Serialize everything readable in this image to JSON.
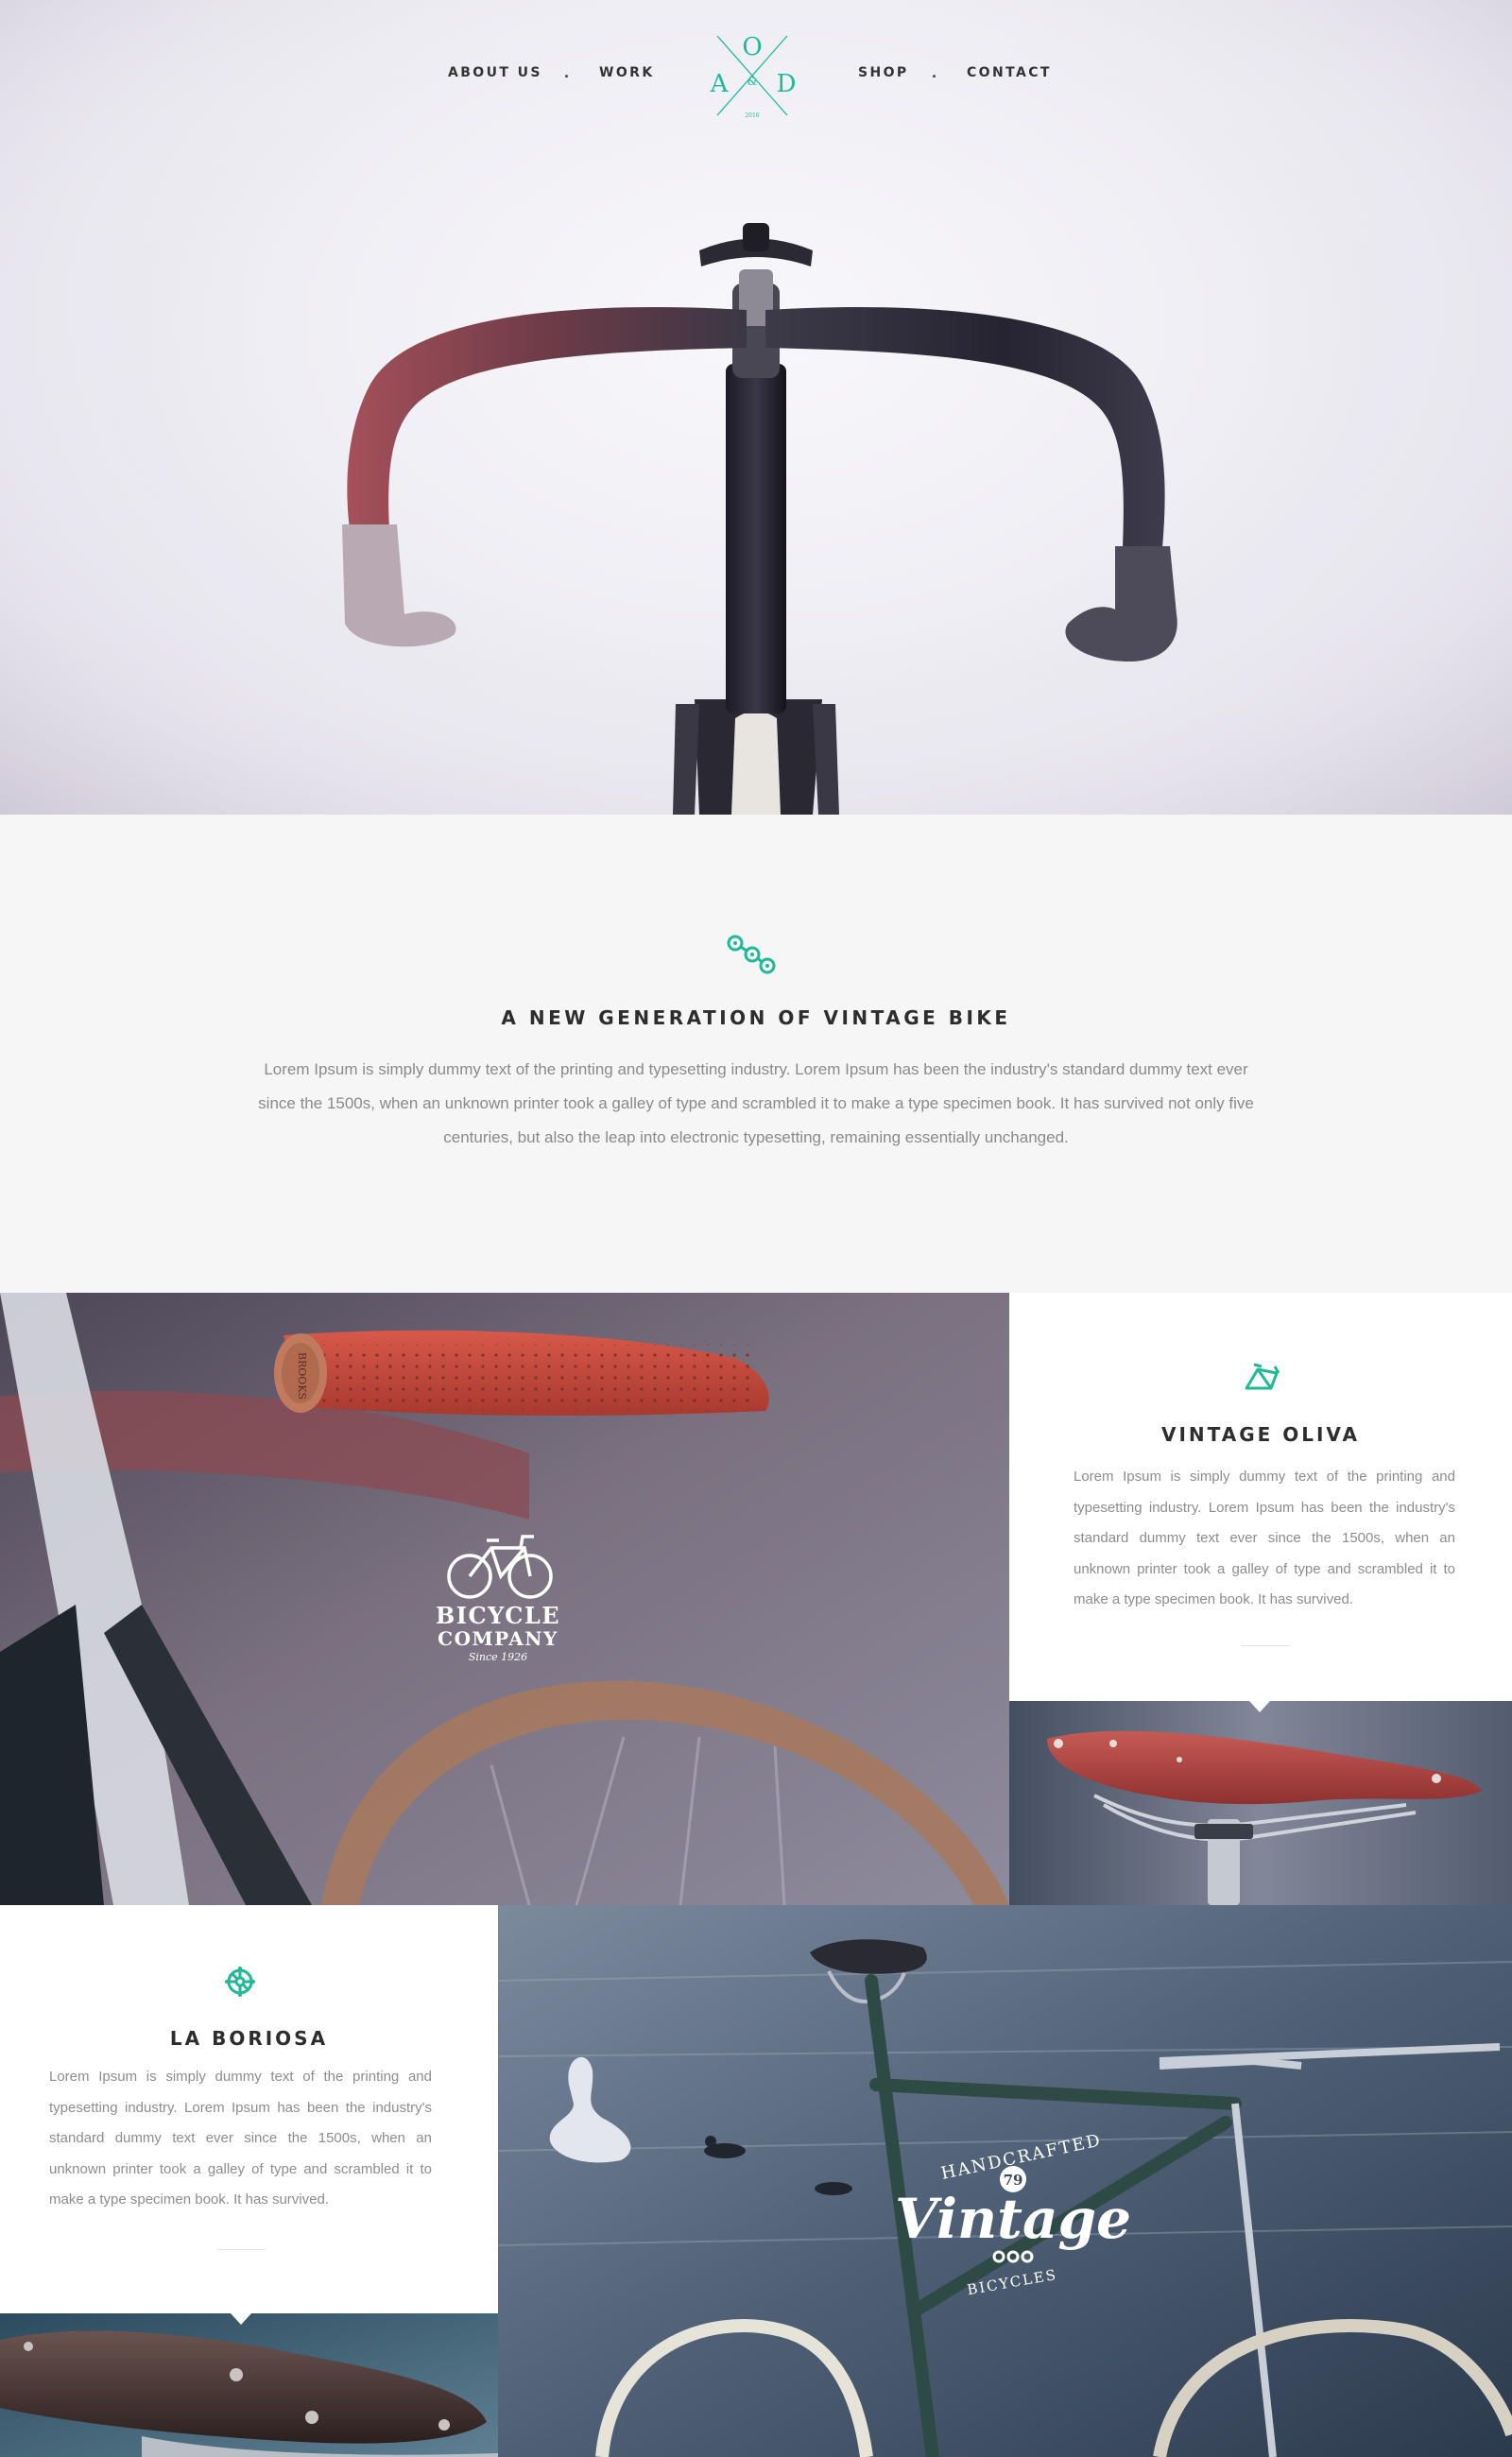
{
  "nav": {
    "about": "ABOUT US",
    "work": "WORK",
    "shop": "SHOP",
    "contact": "CONTACT",
    "separator": ".",
    "logo_left": "A",
    "logo_top": "O",
    "logo_right": "D",
    "logo_amp": "&",
    "logo_year": "2016"
  },
  "intro": {
    "icon": "chain-icon",
    "title": "A NEW GENERATION OF VINTAGE BIKE",
    "body": "Lorem Ipsum is simply dummy text of the printing and typesetting industry. Lorem Ipsum has been the industry's standard dummy text ever since the 1500s, when an unknown printer took a galley of type and scrambled it to make a type specimen book. It has survived not only five centuries, but also the leap into electronic typesetting, remaining essentially unchanged."
  },
  "features": [
    {
      "icon": "bike-frame-icon",
      "title": "VINTAGE OLIVA",
      "body": "Lorem Ipsum is simply dummy text of the printing and typesetting industry. Lorem Ipsum has been the industry's standard dummy text ever since the 1500s, when an unknown printer took a galley of type and scrambled it to make a type specimen book. It has survived."
    },
    {
      "icon": "chainring-icon",
      "title": "LA BORIOSA",
      "body": "Lorem Ipsum is simply dummy text of the printing and typesetting industry. Lorem Ipsum has been the industry's standard dummy text ever since the 1500s, when an unknown printer took a galley of type and scrambled it to make a type specimen book. It has survived."
    }
  ],
  "badges": {
    "bicycle_company_line1": "BICYCLE",
    "bicycle_company_line2": "COMPANY",
    "bicycle_company_since": "Since 1926",
    "grip_brand": "BROOKS",
    "vintage_top": "HANDCRAFTED",
    "vintage_number": "79",
    "vintage_script": "Vintage",
    "vintage_bottom": "BICYCLES"
  },
  "colors": {
    "accent": "#1fb99a",
    "heading": "#2d2d2d",
    "body_text": "#8a8a8a",
    "section_bg": "#f6f6f6",
    "card_bg": "#ffffff"
  }
}
